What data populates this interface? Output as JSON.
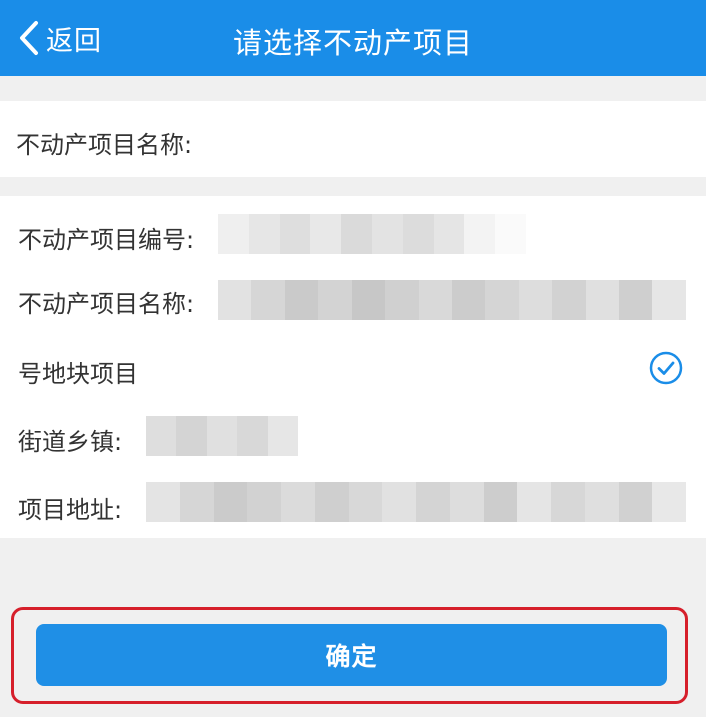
{
  "header": {
    "back_label": "返回",
    "title": "请选择不动产项目",
    "accent_color": "#1a8de8"
  },
  "search": {
    "label": "不动产项目名称:",
    "value": "",
    "placeholder": ""
  },
  "project": {
    "number_label": "不动产项目编号:",
    "name_label": "不动产项目名称:",
    "block_text": "号地块项目",
    "street_label": "街道乡镇:",
    "address_label": "项目地址:",
    "selected": true,
    "redacted_fields": [
      "project-number",
      "project-name",
      "street",
      "address"
    ]
  },
  "icons": {
    "back": "chevron-left-icon",
    "selected": "check-circle-icon"
  },
  "confirm": {
    "label": "确定",
    "highlight_color": "#d61f2b"
  }
}
